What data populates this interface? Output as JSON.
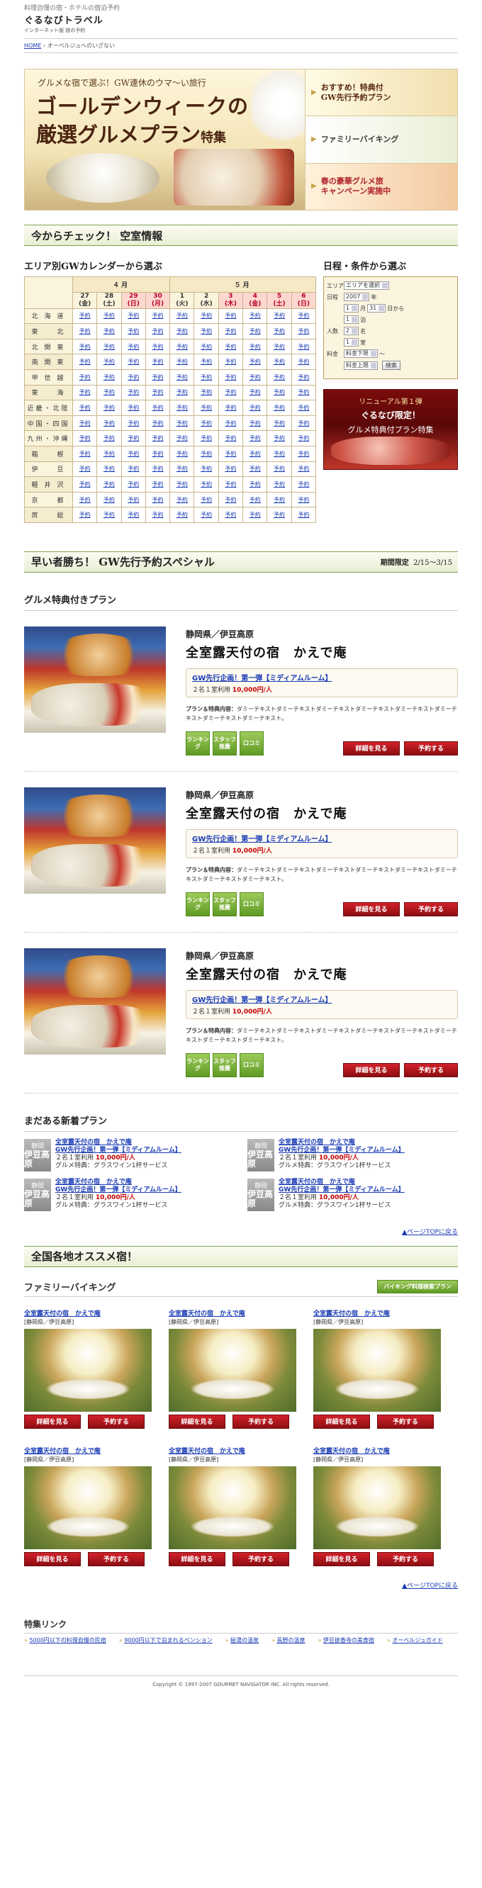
{
  "header": {
    "tagline": "料理自慢の宿・ホテルの宿泊予約",
    "logo_main": "ぐるなびトラベル",
    "logo_sub": "インターネット版 旅の予約",
    "breadcrumb_home": "HOME",
    "breadcrumb_sep": " › ",
    "breadcrumb_current": "オーベルジュへのいざない"
  },
  "hero": {
    "subtitle": "グルメな宿で選ぶ！GW連休のウマ〜い旅行",
    "title_line1": "ゴールデンウィークの",
    "title_line2": "厳選グルメプラン",
    "title_suffix": "特集",
    "side": [
      {
        "label": "おすすめ！特典付\nGW先行予約プラン"
      },
      {
        "label": "ファミリーバイキング"
      },
      {
        "label": "春の豪華グルメ旅\nキャンペーン実施中"
      }
    ]
  },
  "availability": {
    "section_title": "今からチェック！ 空室情報",
    "calendar_title": "エリア別GWカレンダーから選ぶ",
    "months": [
      "４月",
      "５月"
    ],
    "days": [
      {
        "d": "27",
        "w": "(金)",
        "sun": false
      },
      {
        "d": "28",
        "w": "(土)",
        "sun": false
      },
      {
        "d": "29",
        "w": "(日)",
        "sun": true
      },
      {
        "d": "30",
        "w": "(月)",
        "sun": true
      },
      {
        "d": "1",
        "w": "(火)",
        "sun": false
      },
      {
        "d": "2",
        "w": "(水)",
        "sun": false
      },
      {
        "d": "3",
        "w": "(木)",
        "sun": true
      },
      {
        "d": "4",
        "w": "(金)",
        "sun": true
      },
      {
        "d": "5",
        "w": "(土)",
        "sun": true
      },
      {
        "d": "6",
        "w": "(日)",
        "sun": true
      }
    ],
    "cell_label": "予約",
    "areas": [
      "北 海 道",
      "東　　北",
      "北 関 東",
      "南 関 東",
      "甲 信 越",
      "東　　海",
      "近畿・北陸",
      "中国・四国",
      "九州・沖縄",
      "箱　　根",
      "伊　　豆",
      "軽 井 沢",
      "京　　都",
      "房　　総"
    ],
    "search_title": "日程・条件から選ぶ",
    "search": {
      "area_label": "エリア",
      "area_value": "エリアを選択",
      "date_label": "日程",
      "year_value": "2007",
      "year_unit": "年",
      "month_value": "1",
      "month_unit": "月",
      "day_value": "31",
      "day_unit": "日から",
      "nights_value": "1",
      "nights_unit": "泊",
      "people_label": "人数",
      "people_value": "2",
      "people_unit": "名",
      "rooms_value": "1",
      "rooms_unit": "室",
      "price_label": "料金",
      "price_min": "料金下限",
      "price_max": "料金上限",
      "tilde": "〜",
      "search_button": "検索"
    },
    "promo": {
      "line1": "リニューアル第１弾",
      "line2": "ぐるなび限定！",
      "line3": "グルメ特典付プラン特集"
    }
  },
  "early": {
    "section_title": "早い者勝ち！ GW先行予約スペシャル",
    "period_label": "期間限定",
    "period_value": "2/15〜3/15",
    "category_title": "グルメ特典付きプラン",
    "plans": [
      {
        "pref": "静岡県／伊豆高原",
        "name": "全室露天付の宿　かえで庵",
        "link": "GW先行企画！第一弾【ミディアムルーム】",
        "price_prefix": "２名１室利用",
        "price": "10,000円/人",
        "desc_label": "プラン＆特典内容：",
        "desc": "ダミーテキストダミーテキストダミーテキストダミーテキストダミーテキストダミーテキストダミーテキストダミーテキスト。"
      },
      {
        "pref": "静岡県／伊豆高原",
        "name": "全室露天付の宿　かえで庵",
        "link": "GW先行企画！第一弾【ミディアムルーム】",
        "price_prefix": "２名１室利用",
        "price": "10,000円/人",
        "desc_label": "プラン＆特典内容：",
        "desc": "ダミーテキストダミーテキストダミーテキストダミーテキストダミーテキストダミーテキストダミーテキストダミーテキスト。"
      },
      {
        "pref": "静岡県／伊豆高原",
        "name": "全室露天付の宿　かえで庵",
        "link": "GW先行企画！第一弾【ミディアムルーム】",
        "price_prefix": "２名１室利用",
        "price": "10,000円/人",
        "desc_label": "プラン＆特典内容：",
        "desc": "ダミーテキストダミーテキストダミーテキストダミーテキストダミーテキストダミーテキストダミーテキストダミーテキスト。"
      }
    ],
    "btn_ranking": "ランキング",
    "btn_staff": "スタッフ推薦",
    "btn_review": "口コミ",
    "btn_detail": "詳細を見る",
    "btn_reserve": "予約する"
  },
  "newplans": {
    "title": "まだある新着プラン",
    "icon_top": "静岡",
    "icon_bottom": "伊豆高原",
    "items": [
      {
        "name": "全室露天付の宿　かえで庵",
        "link": "GW先行企画！第一弾【ミディアムルーム】",
        "price_prefix": "２名１室利用",
        "price": "10,000円/人",
        "perk": "グルメ特典：グラスワイン1杯サービス"
      },
      {
        "name": "全室露天付の宿　かえで庵",
        "link": "GW先行企画！第一弾【ミディアムルーム】",
        "price_prefix": "２名１室利用",
        "price": "10,000円/人",
        "perk": "グルメ特典：グラスワイン1杯サービス"
      },
      {
        "name": "全室露天付の宿　かえで庵",
        "link": "GW先行企画！第一弾【ミディアムルーム】",
        "price_prefix": "２名１室利用",
        "price": "10,000円/人",
        "perk": "グルメ特典：グラスワイン1杯サービス"
      },
      {
        "name": "全室露天付の宿　かえで庵",
        "link": "GW先行企画！第一弾【ミディアムルーム】",
        "price_prefix": "２名１室利用",
        "price": "10,000円/人",
        "perk": "グルメ特典：グラスワイン1杯サービス"
      }
    ],
    "top_link": "▲ページTOPに戻る"
  },
  "national": {
    "section_title": "全国各地オススメ宿！",
    "family_title": "ファミリーバイキング",
    "family_search": "バイキング料理検索プラン",
    "items": [
      {
        "name": "全室露天付の宿　かえで庵",
        "loc": "[静岡県／伊豆高原]"
      },
      {
        "name": "全室露天付の宿　かえで庵",
        "loc": "[静岡県／伊豆高原]"
      },
      {
        "name": "全室露天付の宿　かえで庵",
        "loc": "[静岡県／伊豆高原]"
      },
      {
        "name": "全室露天付の宿　かえで庵",
        "loc": "[静岡県／伊豆高原]"
      },
      {
        "name": "全室露天付の宿　かえで庵",
        "loc": "[静岡県／伊豆高原]"
      },
      {
        "name": "全室露天付の宿　かえで庵",
        "loc": "[静岡県／伊豆高原]"
      }
    ],
    "btn_detail": "詳細を見る",
    "btn_reserve": "予約する",
    "top_link": "▲ページTOPに戻る"
  },
  "feature_links": {
    "title": "特集リンク",
    "items": [
      "5000円以下の料理自慢の民宿",
      "9000円以下で泊まれるペンション",
      "秘湯の温泉",
      "長野の温泉",
      "伊豆彼香寺の美食宿",
      "オーベルジュガイド"
    ]
  },
  "footer": {
    "copyright": "Copyright © 1997-2007 GOURMET NAVIGATOR INC. All rights reserved."
  }
}
